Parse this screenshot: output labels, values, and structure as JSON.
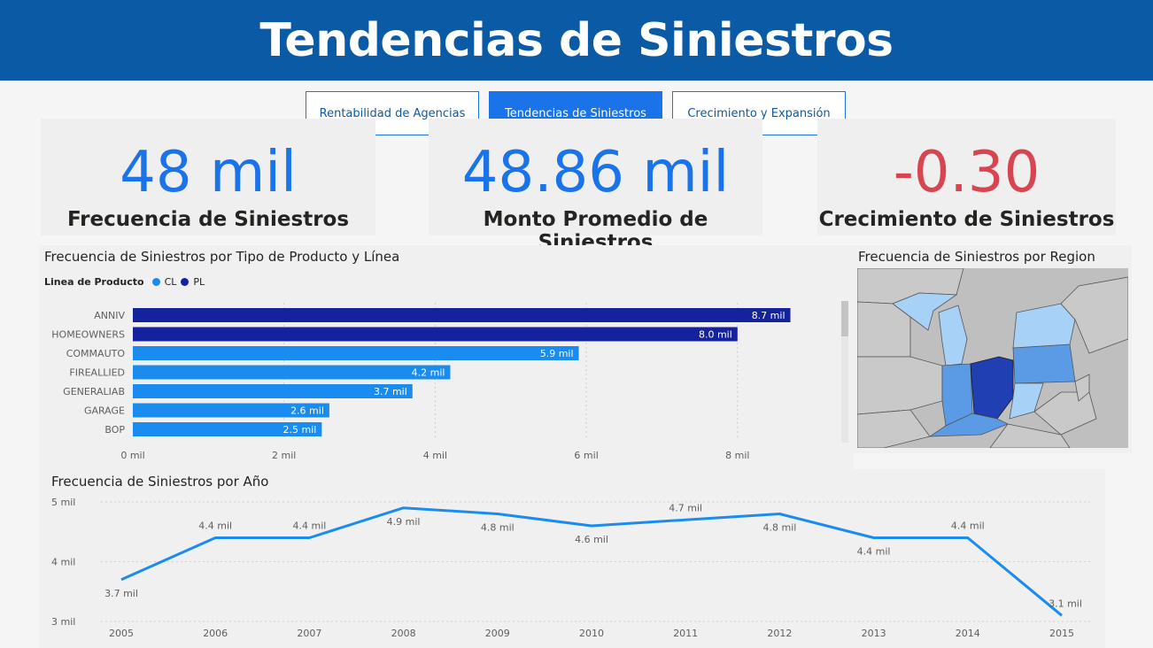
{
  "header": {
    "title": "Tendencias de Siniestros"
  },
  "nav": {
    "buttons": [
      {
        "label": "Rentabilidad de Agencias",
        "active": false
      },
      {
        "label": "Tendencias de Siniestros",
        "active": true
      },
      {
        "label": "Crecimiento y Expansión",
        "active": false
      }
    ]
  },
  "kpis": [
    {
      "value": "48 mil",
      "label": "Frecuencia de Siniestros"
    },
    {
      "value": "48.86 mil",
      "label": "Monto Promedio de Siniestros"
    },
    {
      "value": "-0.30",
      "label": "Crecimiento de Siniestros"
    }
  ],
  "colors": {
    "brand": "#0b5aa6",
    "accent": "#1a73e8",
    "negative": "#d64550",
    "cl": "#1a8cf0",
    "pl": "#14239c"
  },
  "bar_chart": {
    "title": "Frecuencia de Siniestros por Tipo de Producto y Línea",
    "legend_title": "Linea de Producto",
    "legend": [
      {
        "label": "CL",
        "color": "#1a8cf0"
      },
      {
        "label": "PL",
        "color": "#14239c"
      }
    ]
  },
  "map": {
    "title": "Frecuencia de Siniestros por Region"
  },
  "line_chart": {
    "title": "Frecuencia de Siniestros por Año"
  },
  "chart_data": [
    {
      "type": "bar",
      "orientation": "horizontal",
      "title": "Frecuencia de Siniestros por Tipo de Producto y Línea",
      "categories": [
        "ANNIV",
        "HOMEOWNERS",
        "COMMAUTO",
        "FIREALLIED",
        "GENERALIAB",
        "GARAGE",
        "BOP"
      ],
      "values": [
        8.7,
        8.0,
        5.9,
        4.2,
        3.7,
        2.6,
        2.5
      ],
      "data_labels": [
        "8.7 mil",
        "8.0 mil",
        "5.9 mil",
        "4.2 mil",
        "3.7 mil",
        "2.6 mil",
        "2.5 mil"
      ],
      "series_by_category": [
        "PL",
        "PL",
        "CL",
        "CL",
        "CL",
        "CL",
        "CL"
      ],
      "xticks": [
        0,
        2,
        4,
        6,
        8
      ],
      "xtick_labels": [
        "0 mil",
        "2 mil",
        "4 mil",
        "6 mil",
        "8 mil"
      ],
      "xlim": [
        0,
        8.9
      ],
      "grid": true,
      "legend_position": "top-left"
    },
    {
      "type": "line",
      "title": "Frecuencia de Siniestros por Año",
      "x": [
        "2005",
        "2006",
        "2007",
        "2008",
        "2009",
        "2010",
        "2011",
        "2012",
        "2013",
        "2014",
        "2015"
      ],
      "values": [
        3.7,
        4.4,
        4.4,
        4.9,
        4.8,
        4.6,
        4.7,
        4.8,
        4.4,
        4.4,
        3.1
      ],
      "data_labels": [
        "3.7 mil",
        "4.4 mil",
        "4.4 mil",
        "4.9 mil",
        "4.8 mil",
        "4.6 mil",
        "4.7 mil",
        "4.8 mil",
        "4.4 mil",
        "4.4 mil",
        "3.1 mil"
      ],
      "label_placement": [
        "below",
        "above",
        "above",
        "below",
        "below",
        "below",
        "above",
        "below",
        "below",
        "above",
        "above"
      ],
      "yticks": [
        3,
        4,
        5
      ],
      "ytick_labels": [
        "3 mil",
        "4 mil",
        "5 mil"
      ],
      "ylim": [
        3,
        5
      ],
      "grid": true
    }
  ]
}
